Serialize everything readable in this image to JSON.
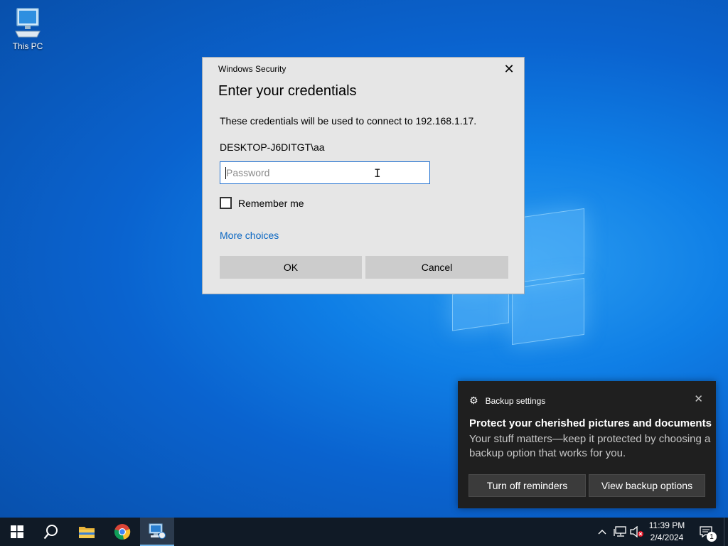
{
  "desktop": {
    "icons": [
      {
        "label": "This PC",
        "icon": "computer-icon"
      }
    ]
  },
  "dialog": {
    "window_title": "Windows Security",
    "heading": "Enter your credentials",
    "description": "These credentials will be used to connect to 192.168.1.17.",
    "username": "DESKTOP-J6DITGT\\aa",
    "password": {
      "placeholder": "Password",
      "value": ""
    },
    "remember_label": "Remember me",
    "remember_checked": false,
    "more_choices": "More choices",
    "ok_label": "OK",
    "cancel_label": "Cancel",
    "close_icon": "close-icon"
  },
  "toast": {
    "app_name": "Backup settings",
    "app_icon": "gear-icon",
    "title": "Protect your cherished pictures and documents",
    "body": "Your stuff matters—keep it protected by choosing a backup option that works for you.",
    "buttons": [
      "Turn off reminders",
      "View backup options"
    ],
    "close_icon": "close-icon"
  },
  "taskbar": {
    "items": [
      {
        "name": "start-button",
        "icon": "windows-icon"
      },
      {
        "name": "search-button",
        "icon": "search-icon"
      },
      {
        "name": "file-explorer",
        "icon": "folder-icon"
      },
      {
        "name": "chrome",
        "icon": "chrome-icon"
      },
      {
        "name": "remote-desktop",
        "icon": "remote-desktop-icon",
        "active": true
      }
    ],
    "tray_icons": [
      "chevron-up-icon",
      "network-icon",
      "volume-muted-icon"
    ],
    "time": "11:39 PM",
    "date": "2/4/2024",
    "notification_count": "1"
  },
  "colors": {
    "accent": "#0b67c2",
    "input_border": "#1f6fd0",
    "taskbar": "#101a26",
    "toast_bg": "#1f1f1f"
  }
}
